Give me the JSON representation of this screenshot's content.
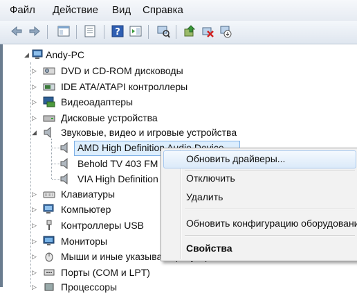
{
  "menubar": {
    "items": [
      {
        "label": "Файл"
      },
      {
        "label": "Действие"
      },
      {
        "label": "Вид"
      },
      {
        "label": "Справка"
      }
    ]
  },
  "tree": {
    "root": "Andy-PC",
    "nodes": [
      {
        "label": "DVD и CD-ROM дисководы",
        "icon": "dvd-drive-icon"
      },
      {
        "label": "IDE ATA/ATAPI контроллеры",
        "icon": "ide-controller-icon"
      },
      {
        "label": "Видеоадаптеры",
        "icon": "display-adapter-icon"
      },
      {
        "label": "Дисковые устройства",
        "icon": "disk-drive-icon"
      },
      {
        "label": "Звуковые, видео и игровые устройства",
        "icon": "speaker-icon",
        "expanded": true,
        "children": [
          {
            "label": "AMD High Definition Audio Device"
          },
          {
            "label": "Behold TV 403 FM"
          },
          {
            "label": "VIA High Definition Audio"
          }
        ]
      },
      {
        "label": "Клавиатуры",
        "icon": "keyboard-icon"
      },
      {
        "label": "Компьютер",
        "icon": "computer-icon"
      },
      {
        "label": "Контроллеры USB",
        "icon": "usb-icon"
      },
      {
        "label": "Мониторы",
        "icon": "monitor-icon"
      },
      {
        "label": "Мыши и иные указывающие устройства",
        "icon": "mouse-icon"
      },
      {
        "label": "Порты (COM и LPT)",
        "icon": "port-icon"
      },
      {
        "label": "Процессоры",
        "icon": "processor-icon"
      }
    ]
  },
  "context_menu": {
    "items": [
      {
        "label": "Обновить драйверы..."
      },
      {
        "label": "Отключить"
      },
      {
        "label": "Удалить"
      },
      {
        "label": "Обновить конфигурацию оборудования"
      },
      {
        "label": "Свойства"
      }
    ]
  },
  "colors": {
    "selection": "#ddeefd",
    "menu_highlight": "#dceaf9"
  }
}
